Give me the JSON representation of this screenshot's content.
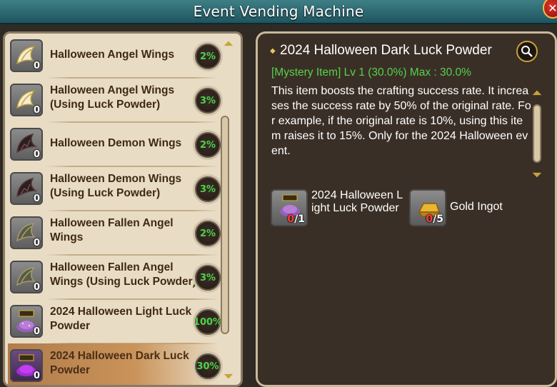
{
  "window": {
    "title": "Event Vending Machine",
    "close_label": "✕"
  },
  "list": {
    "items": [
      {
        "name": "Halloween Angel Wings",
        "count": "0",
        "rate": "2%",
        "icon": "angel-wings-icon"
      },
      {
        "name": "Halloween Angel Wings (Using Luck Powder)",
        "count": "0",
        "rate": "3%",
        "icon": "angel-wings-icon"
      },
      {
        "name": "Halloween Demon Wings",
        "count": "0",
        "rate": "2%",
        "icon": "demon-wings-icon"
      },
      {
        "name": "Halloween Demon Wings (Using Luck Powder)",
        "count": "0",
        "rate": "3%",
        "icon": "demon-wings-icon"
      },
      {
        "name": "Halloween Fallen Angel Wings",
        "count": "0",
        "rate": "2%",
        "icon": "fallen-angel-wings-icon"
      },
      {
        "name": "Halloween Fallen Angel Wings (Using Luck Powder)",
        "count": "0",
        "rate": "3%",
        "icon": "fallen-angel-wings-icon"
      },
      {
        "name": "2024 Halloween Light Luck Powder",
        "count": "0",
        "rate": "100%",
        "icon": "light-luck-powder-icon"
      },
      {
        "name": "2024 Halloween Dark Luck Powder",
        "count": "0",
        "rate": "30%",
        "icon": "dark-luck-powder-icon"
      }
    ]
  },
  "detail": {
    "title": "2024 Halloween Dark Luck Powder",
    "subtitle": "[Mystery Item] Lv 1  (30.0%) Max : 30.0%",
    "description": "This item boosts the crafting success rate. It increases the success rate by 50% of the original rate. For example, if the original rate is 10%, using this item raises it to 15%. Only for the 2024 Halloween event.",
    "materials": [
      {
        "name": "2024 Halloween Light Luck Powder",
        "have": "0",
        "need": "/1",
        "icon": "light-luck-powder-icon"
      },
      {
        "name": "Gold Ingot",
        "have": "0",
        "need": "/5",
        "icon": "gold-ingot-icon"
      }
    ]
  },
  "colors": {
    "title_bar": "#2f6b73",
    "rate_text": "#4cd24a",
    "subtitle": "#55d24c",
    "have_count": "#ff3a3a"
  }
}
